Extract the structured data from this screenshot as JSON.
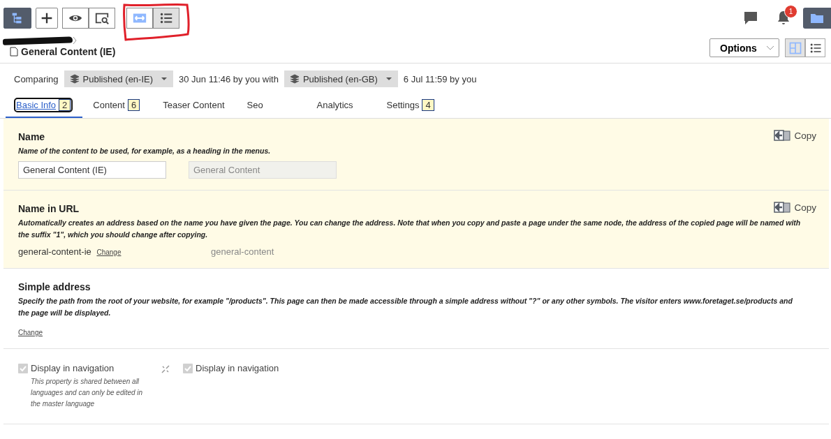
{
  "toolbar": {
    "items": [
      {
        "kind": "tree"
      },
      {
        "kind": "add"
      },
      {
        "kind": "preview"
      },
      {
        "kind": "view"
      },
      {
        "kind": "compare",
        "selected": true
      },
      {
        "kind": "list",
        "selected": true
      }
    ],
    "notifications": {
      "count": "1"
    }
  },
  "header": {
    "title": "General Content (IE)",
    "options": "Options",
    "views": [
      {
        "kind": "split",
        "selected": true
      },
      {
        "kind": "list",
        "selected": false
      }
    ]
  },
  "compare": {
    "label": "Comparing",
    "left_version": "Published (en-IE)",
    "left_meta": "30 Jun 11:46 by you with",
    "right_version": "Published (en-GB)",
    "right_meta": "6 Jul 11:59 by you"
  },
  "tabs": [
    {
      "label": "Basic Info",
      "count": "2",
      "selected": true,
      "focused": true
    },
    {
      "label": "Content",
      "count": "6",
      "selected": false,
      "focused": false
    },
    {
      "label": "Teaser Content",
      "selected": false,
      "focused": false
    },
    {
      "label": "Seo",
      "selected": false,
      "focused": false
    },
    {
      "label": "Analytics",
      "selected": false,
      "focused": false
    },
    {
      "label": "Settings",
      "count": "4",
      "selected": false,
      "focused": false
    }
  ],
  "sections": [
    {
      "kind": "text",
      "changed": true,
      "title": "Name",
      "description": "Name of the content to be used, for example, as a heading in the menus.",
      "value": "General Content (IE)",
      "compare_value": "General Content",
      "copy": "Copy"
    },
    {
      "kind": "url",
      "changed": true,
      "title": "Name in URL",
      "description": "Automatically creates an address based on the name you have given the page. You can change the address. Note that when you copy and paste a page under the same node, the address of the copied page will be named with the suffix \"1\", which you should change after copying.",
      "value": "general-content-ie",
      "change": "Change",
      "compare_value": "general-content",
      "copy": "Copy"
    },
    {
      "kind": "simple",
      "changed": false,
      "title": "Simple address",
      "description": "Specify the path from the root of your website, for example \"/products\". This page can then be made accessible through a simple address without \"?\" or any other symbols. The visitor enters www.foretaget.se/products and the page will be displayed.",
      "change": "Change"
    },
    {
      "kind": "checkbox",
      "changed": false,
      "label": "Display in navigation",
      "checked": true,
      "disabled": true,
      "note": "This property is shared between all languages and can only be edited in the master language",
      "compare_label": "Display in navigation",
      "compare_checked": true
    }
  ]
}
